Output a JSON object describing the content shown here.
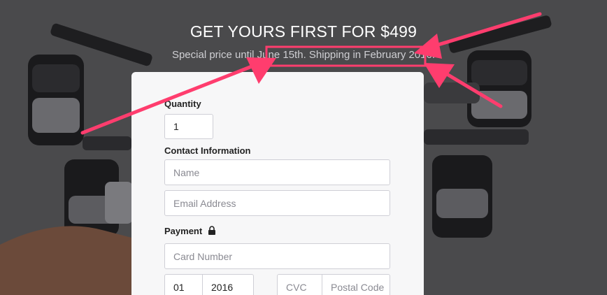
{
  "header": {
    "title": "GET YOURS FIRST FOR $499",
    "subtitle": "Special price until June 15th. Shipping in February 2016."
  },
  "form": {
    "quantity_label": "Quantity",
    "quantity_value": "1",
    "contact_label": "Contact Information",
    "name_placeholder": "Name",
    "email_placeholder": "Email Address",
    "payment_label": "Payment",
    "card_placeholder": "Card Number",
    "exp_month": "01",
    "exp_year": "2016",
    "cvc_placeholder": "CVC",
    "postal_placeholder": "Postal Code"
  },
  "icons": {
    "payment_lock": "lock-icon"
  },
  "colors": {
    "background": "#4a4a4c",
    "card": "#f7f7f8",
    "annotation": "#ff3d6e"
  }
}
